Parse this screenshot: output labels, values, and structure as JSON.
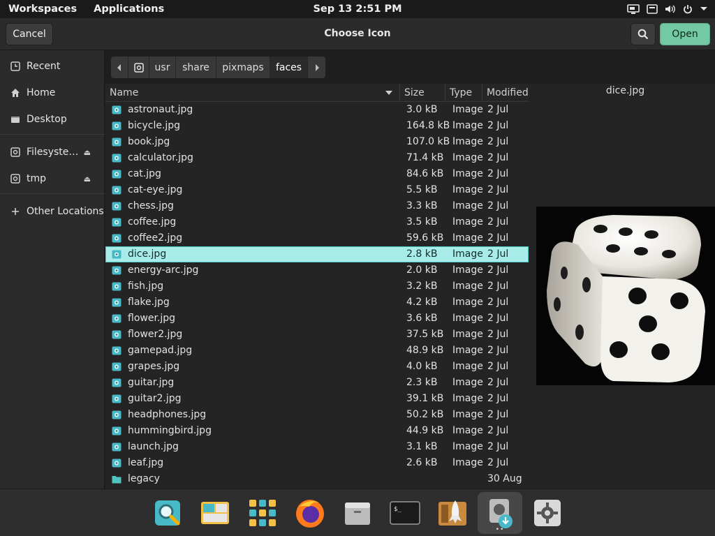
{
  "topbar": {
    "workspaces": "Workspaces",
    "applications": "Applications",
    "clock": "Sep 13   2:51 PM",
    "icons": [
      "display-icon",
      "keyboard-icon",
      "volume-icon",
      "power-icon",
      "chevron-down-icon"
    ]
  },
  "dialog": {
    "title": "Choose Icon",
    "cancel_label": "Cancel",
    "open_label": "Open",
    "accent": "#72c9a3"
  },
  "sidebar": {
    "items": [
      {
        "label": "Recent",
        "icon": "clock-icon"
      },
      {
        "label": "Home",
        "icon": "home-icon"
      },
      {
        "label": "Desktop",
        "icon": "desktop-icon"
      },
      {
        "label": "Filesyste…",
        "icon": "drive-icon",
        "eject": true
      },
      {
        "label": "tmp",
        "icon": "drive-icon",
        "eject": true
      },
      {
        "label": "Other Locations",
        "icon": "plus-icon"
      }
    ]
  },
  "pathbar": {
    "segments": [
      "usr",
      "share",
      "pixmaps",
      "faces"
    ],
    "active": "faces"
  },
  "columns": {
    "name": "Name",
    "size": "Size",
    "type": "Type",
    "modified": "Modified"
  },
  "files": [
    {
      "name": "astronaut.jpg",
      "size": "3.0 kB",
      "type": "Image",
      "modified": "2 Jul"
    },
    {
      "name": "bicycle.jpg",
      "size": "164.8 kB",
      "type": "Image",
      "modified": "2 Jul"
    },
    {
      "name": "book.jpg",
      "size": "107.0 kB",
      "type": "Image",
      "modified": "2 Jul"
    },
    {
      "name": "calculator.jpg",
      "size": "71.4 kB",
      "type": "Image",
      "modified": "2 Jul"
    },
    {
      "name": "cat.jpg",
      "size": "84.6 kB",
      "type": "Image",
      "modified": "2 Jul"
    },
    {
      "name": "cat-eye.jpg",
      "size": "5.5 kB",
      "type": "Image",
      "modified": "2 Jul"
    },
    {
      "name": "chess.jpg",
      "size": "3.3 kB",
      "type": "Image",
      "modified": "2 Jul"
    },
    {
      "name": "coffee.jpg",
      "size": "3.5 kB",
      "type": "Image",
      "modified": "2 Jul"
    },
    {
      "name": "coffee2.jpg",
      "size": "59.6 kB",
      "type": "Image",
      "modified": "2 Jul"
    },
    {
      "name": "dice.jpg",
      "size": "2.8 kB",
      "type": "Image",
      "modified": "2 Jul",
      "selected": true
    },
    {
      "name": "energy-arc.jpg",
      "size": "2.0 kB",
      "type": "Image",
      "modified": "2 Jul"
    },
    {
      "name": "fish.jpg",
      "size": "3.2 kB",
      "type": "Image",
      "modified": "2 Jul"
    },
    {
      "name": "flake.jpg",
      "size": "4.2 kB",
      "type": "Image",
      "modified": "2 Jul"
    },
    {
      "name": "flower.jpg",
      "size": "3.6 kB",
      "type": "Image",
      "modified": "2 Jul"
    },
    {
      "name": "flower2.jpg",
      "size": "37.5 kB",
      "type": "Image",
      "modified": "2 Jul"
    },
    {
      "name": "gamepad.jpg",
      "size": "48.9 kB",
      "type": "Image",
      "modified": "2 Jul"
    },
    {
      "name": "grapes.jpg",
      "size": "4.0 kB",
      "type": "Image",
      "modified": "2 Jul"
    },
    {
      "name": "guitar.jpg",
      "size": "2.3 kB",
      "type": "Image",
      "modified": "2 Jul"
    },
    {
      "name": "guitar2.jpg",
      "size": "39.1 kB",
      "type": "Image",
      "modified": "2 Jul"
    },
    {
      "name": "headphones.jpg",
      "size": "50.2 kB",
      "type": "Image",
      "modified": "2 Jul"
    },
    {
      "name": "hummingbird.jpg",
      "size": "44.9 kB",
      "type": "Image",
      "modified": "2 Jul"
    },
    {
      "name": "launch.jpg",
      "size": "3.1 kB",
      "type": "Image",
      "modified": "2 Jul"
    },
    {
      "name": "leaf.jpg",
      "size": "2.6 kB",
      "type": "Image",
      "modified": "2 Jul"
    },
    {
      "name": "legacy",
      "size": "",
      "type": "",
      "modified": "30 Aug",
      "folder": true
    }
  ],
  "preview": {
    "filename": "dice.jpg"
  },
  "dock": {
    "apps": [
      "search-app-icon",
      "workspaces-app-icon",
      "app-grid-icon",
      "firefox-icon",
      "files-icon",
      "terminal-icon",
      "rocket-app-icon",
      "installer-icon",
      "settings-icon"
    ],
    "active": "installer-icon"
  },
  "colors": {
    "selection": "#a8ecea",
    "folder_icon": "#4fc5c2"
  }
}
